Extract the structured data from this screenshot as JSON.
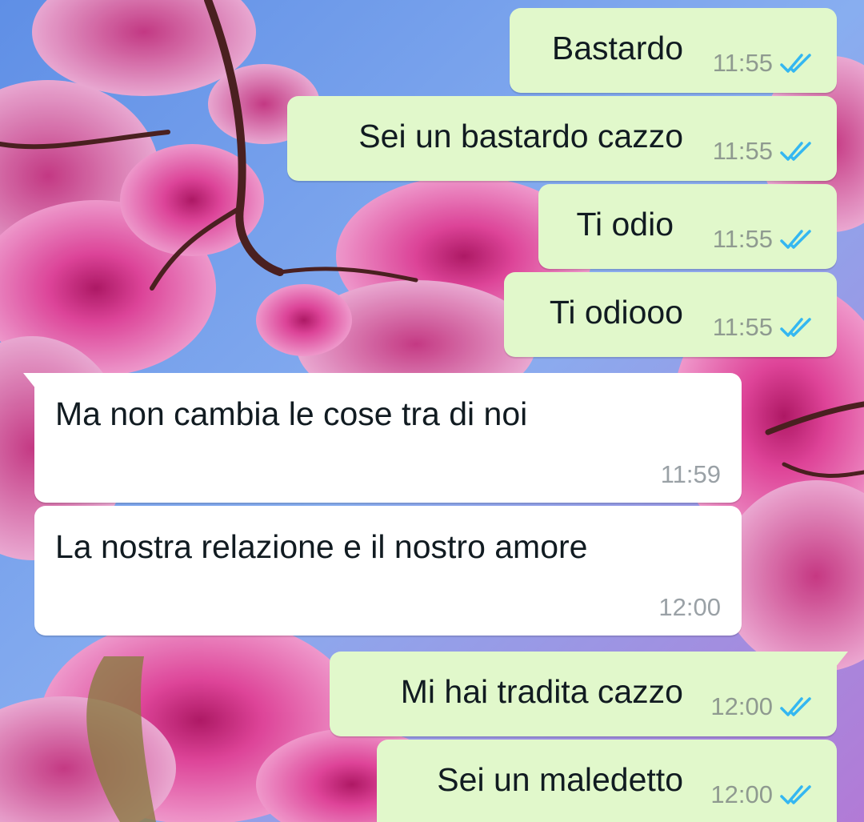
{
  "chat": {
    "messages": [
      {
        "direction": "out",
        "text": "Bastardo",
        "time": "11:55",
        "status": "read-double-check-icon"
      },
      {
        "direction": "out",
        "text": "Sei un bastardo cazzo",
        "time": "11:55",
        "status": "read-double-check-icon"
      },
      {
        "direction": "out",
        "text": "Ti odio",
        "time": "11:55",
        "status": "read-double-check-icon"
      },
      {
        "direction": "out",
        "text": "Ti odiooo",
        "time": "11:55",
        "status": "read-double-check-icon"
      },
      {
        "direction": "in",
        "text": "Ma non cambia le cose tra di noi",
        "time": "11:59"
      },
      {
        "direction": "in",
        "text": "La nostra relazione e il nostro amore",
        "time": "12:00"
      },
      {
        "direction": "out",
        "text": "Mi hai tradita cazzo",
        "time": "12:00",
        "status": "read-double-check-icon"
      },
      {
        "direction": "out",
        "text": "Sei un maledetto",
        "time": "12:00",
        "status": "read-double-check-icon"
      }
    ]
  },
  "colors": {
    "outgoing_bubble": "#e1f8cb",
    "incoming_bubble": "#ffffff",
    "read_ticks": "#34b7f1",
    "wallpaper_sky": "#6f9ce9",
    "wallpaper_blossom": "#e85aa8"
  }
}
